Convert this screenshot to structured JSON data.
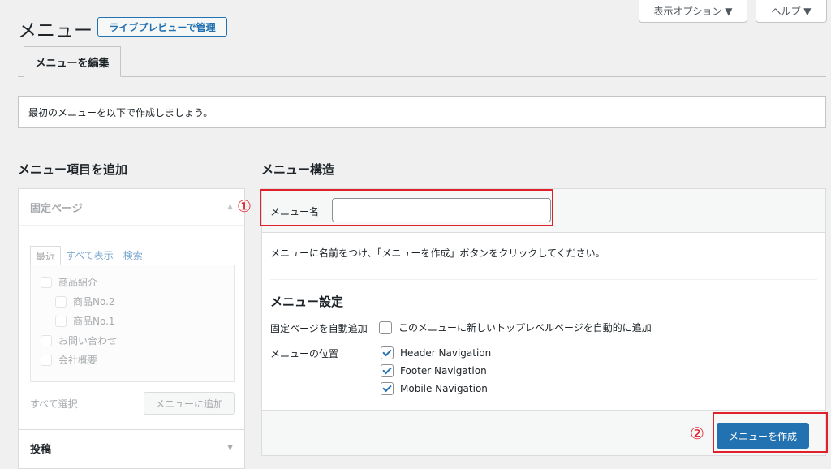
{
  "screen_meta": {
    "options_label": "表示オプション ▼",
    "help_label": "ヘルプ ▼"
  },
  "header": {
    "title": "メニュー",
    "live_preview_label": "ライブプレビューで管理"
  },
  "tabs": [
    {
      "label": "メニューを編集"
    }
  ],
  "notice": "最初のメニューを以下で作成しましょう。",
  "left": {
    "heading": "メニュー項目を追加",
    "pages_section": {
      "title": "固定ページ",
      "tabs": [
        "最近",
        "すべて表示",
        "検索"
      ],
      "items": [
        "商品紹介",
        "商品No.2",
        "商品No.1",
        "お問い合わせ",
        "会社概要"
      ],
      "select_all": "すべて選択",
      "add_button": "メニューに追加"
    },
    "posts_section": {
      "title": "投稿"
    }
  },
  "right": {
    "heading": "メニュー構造",
    "name_label": "メニュー名",
    "name_value": "",
    "instruction": "メニューに名前をつけ、「メニューを作成」ボタンをクリックしてください。",
    "settings_heading": "メニュー設定",
    "auto_add_label": "固定ページを自動追加",
    "auto_add_text": "このメニューに新しいトップレベルページを自動的に追加",
    "location_label": "メニューの位置",
    "locations": [
      "Header Navigation",
      "Footer Navigation",
      "Mobile Navigation"
    ],
    "create_button": "メニューを作成"
  },
  "annotations": {
    "one": "①",
    "two": "②"
  },
  "colors": {
    "primary": "#2271b1",
    "annotation": "#e0202a"
  }
}
